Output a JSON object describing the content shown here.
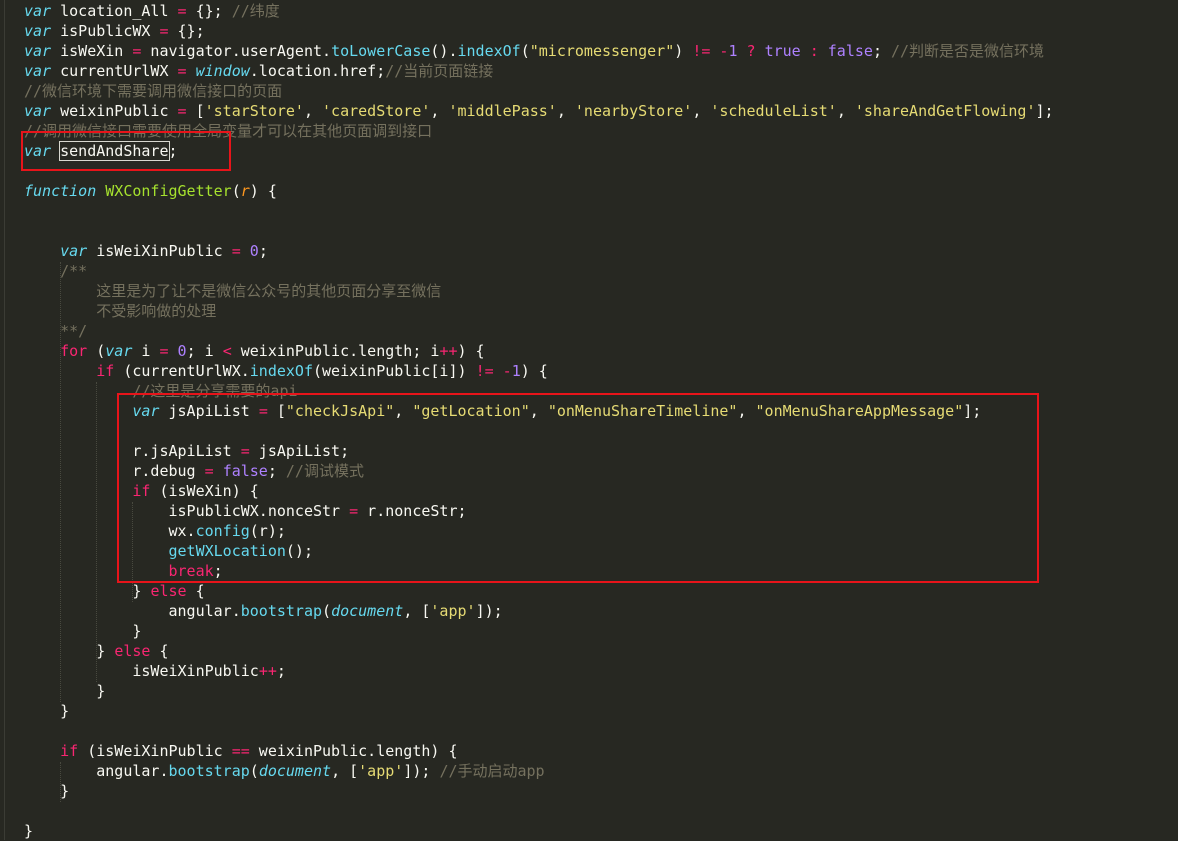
{
  "code_lines": [
    [
      [
        "k",
        "var"
      ],
      [
        "t",
        " location_All "
      ],
      [
        "o",
        "="
      ],
      [
        "t",
        " {}; "
      ],
      [
        "c",
        "//纬度"
      ]
    ],
    [
      [
        "k",
        "var"
      ],
      [
        "t",
        " isPublicWX "
      ],
      [
        "o",
        "="
      ],
      [
        "t",
        " {};"
      ]
    ],
    [
      [
        "k",
        "var"
      ],
      [
        "t",
        " isWeXin "
      ],
      [
        "o",
        "="
      ],
      [
        "t",
        " navigator.userAgent."
      ],
      [
        "f",
        "toLowerCase"
      ],
      [
        "t",
        "()."
      ],
      [
        "f",
        "indexOf"
      ],
      [
        "t",
        "("
      ],
      [
        "s",
        "\"micromessenger\""
      ],
      [
        "t",
        ") "
      ],
      [
        "o",
        "!="
      ],
      [
        "t",
        " "
      ],
      [
        "o",
        "-"
      ],
      [
        "n",
        "1"
      ],
      [
        "t",
        " "
      ],
      [
        "o",
        "?"
      ],
      [
        "t",
        " "
      ],
      [
        "n",
        "true"
      ],
      [
        "t",
        " "
      ],
      [
        "o",
        ":"
      ],
      [
        "t",
        " "
      ],
      [
        "n",
        "false"
      ],
      [
        "t",
        "; "
      ],
      [
        "c",
        "//判断是否是微信环境"
      ]
    ],
    [
      [
        "k",
        "var"
      ],
      [
        "t",
        " currentUrlWX "
      ],
      [
        "o",
        "="
      ],
      [
        "t",
        " "
      ],
      [
        "k",
        "window"
      ],
      [
        "t",
        ".location.href;"
      ],
      [
        "c",
        "//当前页面链接"
      ]
    ],
    [
      [
        "c",
        "//微信环境下需要调用微信接口的页面"
      ]
    ],
    [
      [
        "k",
        "var"
      ],
      [
        "t",
        " weixinPublic "
      ],
      [
        "o",
        "="
      ],
      [
        "t",
        " ["
      ],
      [
        "s",
        "'starStore'"
      ],
      [
        "t",
        ", "
      ],
      [
        "s",
        "'caredStore'"
      ],
      [
        "t",
        ", "
      ],
      [
        "s",
        "'middlePass'"
      ],
      [
        "t",
        ", "
      ],
      [
        "s",
        "'nearbyStore'"
      ],
      [
        "t",
        ", "
      ],
      [
        "s",
        "'scheduleList'"
      ],
      [
        "t",
        ", "
      ],
      [
        "s",
        "'shareAndGetFlowing'"
      ],
      [
        "t",
        "];"
      ]
    ],
    [
      [
        "c",
        "//调用微信接口需要使用全局变量才可以在其他页面调到接口"
      ]
    ],
    [
      [
        "k",
        "var"
      ],
      [
        "t",
        " "
      ],
      [
        "sel",
        "sendAndShare"
      ],
      [
        "t",
        ";"
      ]
    ],
    [],
    [
      [
        "k",
        "function"
      ],
      [
        "t",
        " "
      ],
      [
        "fn",
        "WXConfigGetter"
      ],
      [
        "t",
        "("
      ],
      [
        "p",
        "r"
      ],
      [
        "t",
        ") {"
      ]
    ],
    [],
    [],
    [
      [
        "t",
        "    "
      ],
      [
        "k",
        "var"
      ],
      [
        "t",
        " isWeiXinPublic "
      ],
      [
        "o",
        "="
      ],
      [
        "t",
        " "
      ],
      [
        "n",
        "0"
      ],
      [
        "t",
        ";"
      ]
    ],
    [
      [
        "t",
        "    "
      ],
      [
        "c",
        "/**"
      ]
    ],
    [
      [
        "t",
        "    "
      ],
      [
        "c",
        "    这里是为了让不是微信公众号的其他页面分享至微信"
      ]
    ],
    [
      [
        "t",
        "    "
      ],
      [
        "c",
        "    不受影响做的处理"
      ]
    ],
    [
      [
        "t",
        "    "
      ],
      [
        "c",
        "**/"
      ]
    ],
    [
      [
        "t",
        "    "
      ],
      [
        "kw",
        "for"
      ],
      [
        "t",
        " ("
      ],
      [
        "k",
        "var"
      ],
      [
        "t",
        " i "
      ],
      [
        "o",
        "="
      ],
      [
        "t",
        " "
      ],
      [
        "n",
        "0"
      ],
      [
        "t",
        "; i "
      ],
      [
        "o",
        "<"
      ],
      [
        "t",
        " weixinPublic.length; i"
      ],
      [
        "o",
        "++"
      ],
      [
        "t",
        ") {"
      ]
    ],
    [
      [
        "t",
        "        "
      ],
      [
        "kw",
        "if"
      ],
      [
        "t",
        " (currentUrlWX."
      ],
      [
        "f",
        "indexOf"
      ],
      [
        "t",
        "(weixinPublic[i]) "
      ],
      [
        "o",
        "!="
      ],
      [
        "t",
        " "
      ],
      [
        "o",
        "-"
      ],
      [
        "n",
        "1"
      ],
      [
        "t",
        ") {"
      ]
    ],
    [
      [
        "t",
        "            "
      ],
      [
        "c",
        "//这里是分享需要的api"
      ]
    ],
    [
      [
        "t",
        "            "
      ],
      [
        "k",
        "var"
      ],
      [
        "t",
        " jsApiList "
      ],
      [
        "o",
        "="
      ],
      [
        "t",
        " ["
      ],
      [
        "s",
        "\"checkJsApi\""
      ],
      [
        "t",
        ", "
      ],
      [
        "s",
        "\"getLocation\""
      ],
      [
        "t",
        ", "
      ],
      [
        "s",
        "\"onMenuShareTimeline\""
      ],
      [
        "t",
        ", "
      ],
      [
        "s",
        "\"onMenuShareAppMessage\""
      ],
      [
        "t",
        "];"
      ]
    ],
    [],
    [
      [
        "t",
        "            r.jsApiList "
      ],
      [
        "o",
        "="
      ],
      [
        "t",
        " jsApiList;"
      ]
    ],
    [
      [
        "t",
        "            r.debug "
      ],
      [
        "o",
        "="
      ],
      [
        "t",
        " "
      ],
      [
        "n",
        "false"
      ],
      [
        "t",
        "; "
      ],
      [
        "c",
        "//调试模式"
      ]
    ],
    [
      [
        "t",
        "            "
      ],
      [
        "kw",
        "if"
      ],
      [
        "t",
        " (isWeXin) {"
      ]
    ],
    [
      [
        "t",
        "                isPublicWX.nonceStr "
      ],
      [
        "o",
        "="
      ],
      [
        "t",
        " r.nonceStr;"
      ]
    ],
    [
      [
        "t",
        "                wx."
      ],
      [
        "f",
        "config"
      ],
      [
        "t",
        "(r);"
      ]
    ],
    [
      [
        "t",
        "                "
      ],
      [
        "f",
        "getWXLocation"
      ],
      [
        "t",
        "();"
      ]
    ],
    [
      [
        "t",
        "                "
      ],
      [
        "kw",
        "break"
      ],
      [
        "t",
        ";"
      ]
    ],
    [
      [
        "t",
        "            } "
      ],
      [
        "kw",
        "else"
      ],
      [
        "t",
        " {"
      ]
    ],
    [
      [
        "t",
        "                angular."
      ],
      [
        "f",
        "bootstrap"
      ],
      [
        "t",
        "("
      ],
      [
        "k",
        "document"
      ],
      [
        "t",
        ", ["
      ],
      [
        "s",
        "'app'"
      ],
      [
        "t",
        "]);"
      ]
    ],
    [
      [
        "t",
        "            }"
      ]
    ],
    [
      [
        "t",
        "        } "
      ],
      [
        "kw",
        "else"
      ],
      [
        "t",
        " {"
      ]
    ],
    [
      [
        "t",
        "            isWeiXinPublic"
      ],
      [
        "o",
        "++"
      ],
      [
        "t",
        ";"
      ]
    ],
    [
      [
        "t",
        "        }"
      ]
    ],
    [
      [
        "t",
        "    }"
      ]
    ],
    [],
    [
      [
        "t",
        "    "
      ],
      [
        "kw",
        "if"
      ],
      [
        "t",
        " (isWeiXinPublic "
      ],
      [
        "o",
        "=="
      ],
      [
        "t",
        " weixinPublic.length) {"
      ]
    ],
    [
      [
        "t",
        "        angular."
      ],
      [
        "f",
        "bootstrap"
      ],
      [
        "t",
        "("
      ],
      [
        "k",
        "document"
      ],
      [
        "t",
        ", ["
      ],
      [
        "s",
        "'app'"
      ],
      [
        "t",
        "]); "
      ],
      [
        "c",
        "//手动启动app"
      ]
    ],
    [
      [
        "t",
        "    }"
      ]
    ],
    [],
    [
      [
        "t",
        "}"
      ]
    ]
  ],
  "colors": {
    "background": "#272822",
    "text": "#F8F8F2",
    "highlight_box": "#e8141a"
  }
}
